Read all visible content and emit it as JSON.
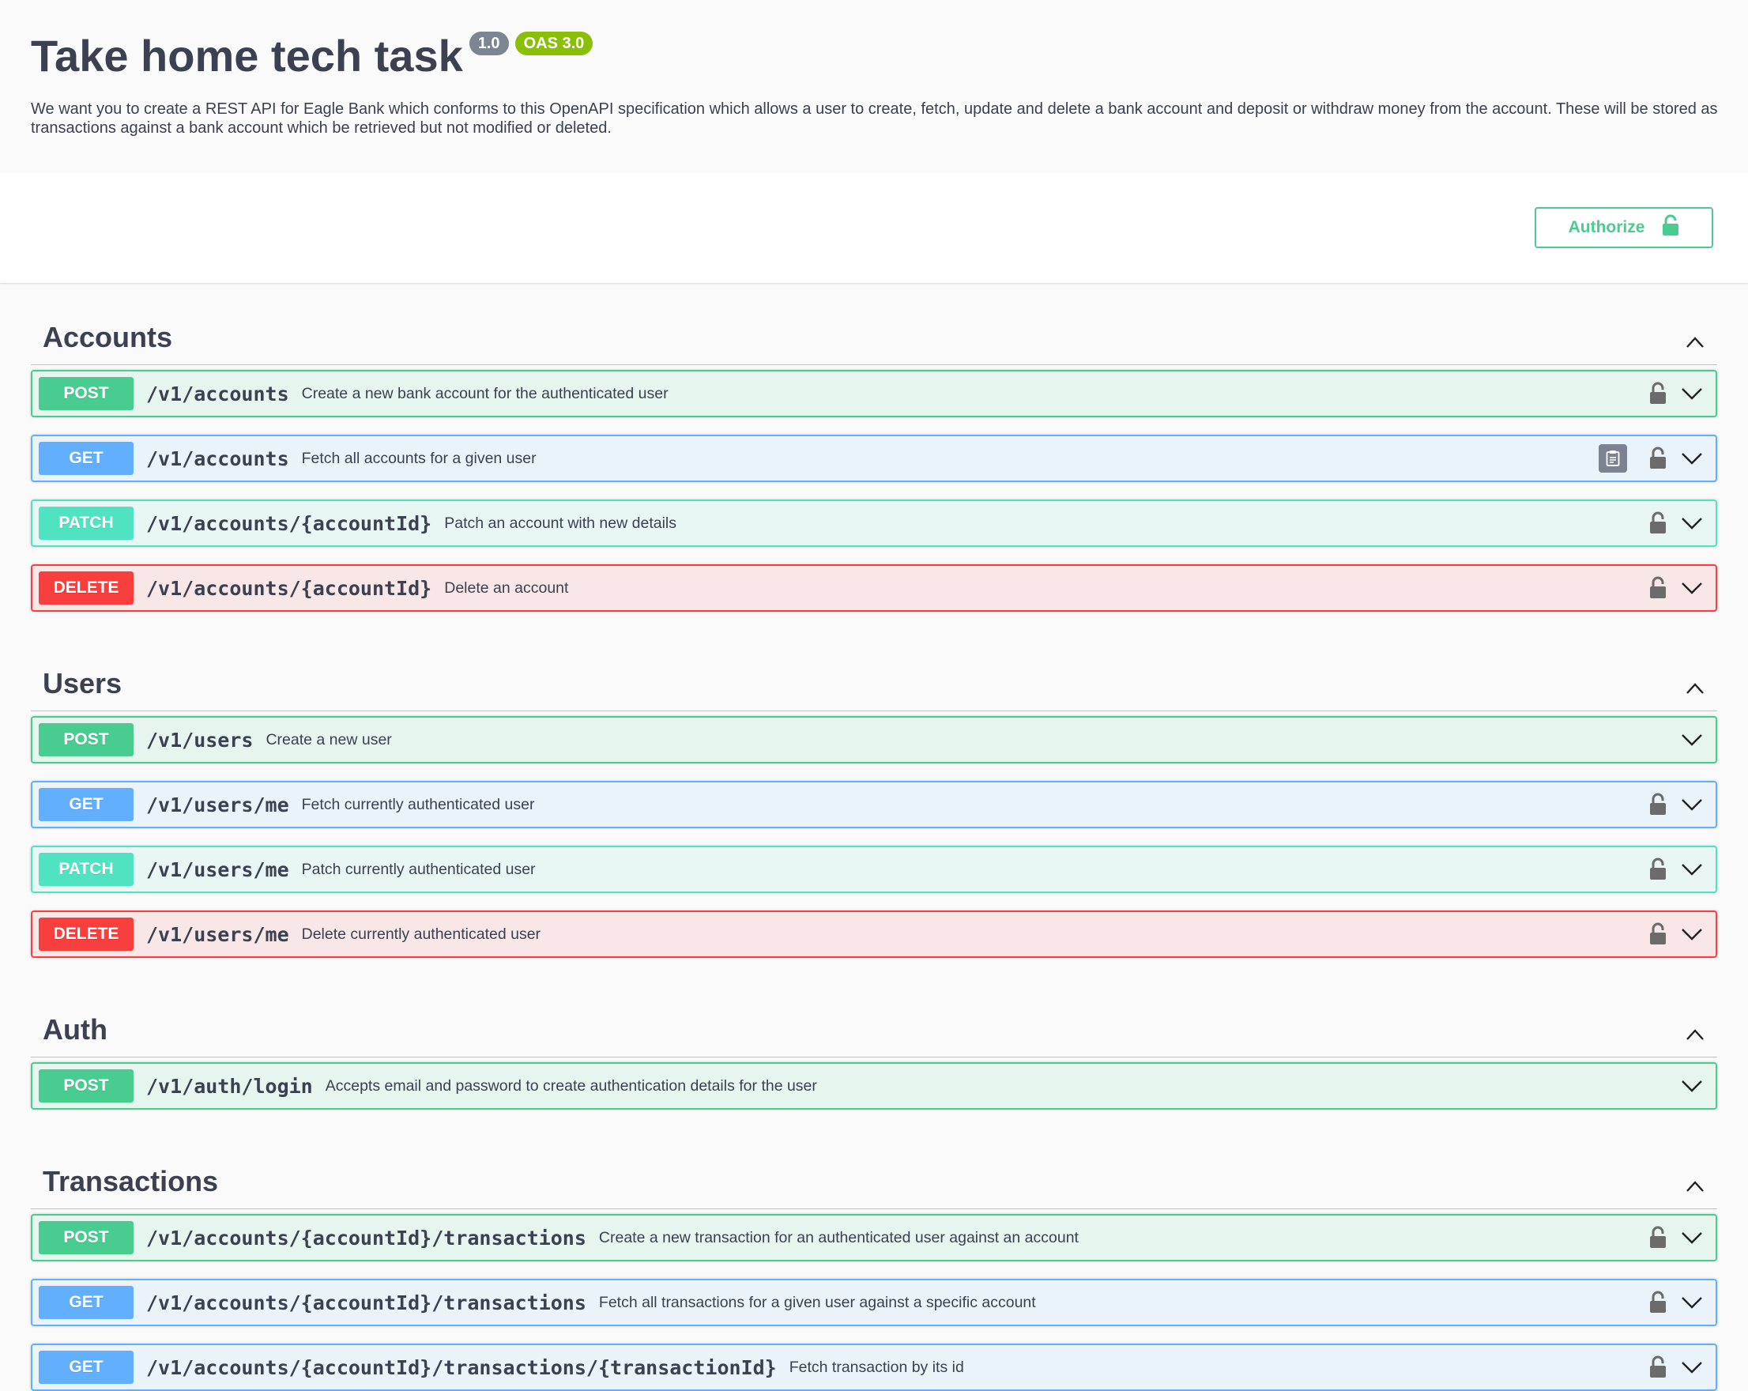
{
  "info": {
    "title": "Take home tech task",
    "version": "1.0",
    "oas": "OAS 3.0",
    "description": "We want you to create a REST API for Eagle Bank which conforms to this OpenAPI specification which allows a user to create, fetch, update and delete a bank account and deposit or withdraw money from the account. These will be stored as transactions against a bank account which be retrieved but not modified or deleted."
  },
  "authorize": {
    "label": "Authorize"
  },
  "tags": [
    {
      "name": "Accounts",
      "ops": [
        {
          "method": "POST",
          "path": "/v1/accounts",
          "summary": "Create a new bank account for the authenticated user",
          "lock": true
        },
        {
          "method": "GET",
          "path": "/v1/accounts",
          "summary": "Fetch all accounts for a given user",
          "lock": true,
          "copy": true
        },
        {
          "method": "PATCH",
          "path": "/v1/accounts/{accountId}",
          "summary": "Patch an account with new details",
          "lock": true
        },
        {
          "method": "DELETE",
          "path": "/v1/accounts/{accountId}",
          "summary": "Delete an account",
          "lock": true
        }
      ]
    },
    {
      "name": "Users",
      "ops": [
        {
          "method": "POST",
          "path": "/v1/users",
          "summary": "Create a new user",
          "lock": false
        },
        {
          "method": "GET",
          "path": "/v1/users/me",
          "summary": "Fetch currently authenticated user",
          "lock": true
        },
        {
          "method": "PATCH",
          "path": "/v1/users/me",
          "summary": "Patch currently authenticated user",
          "lock": true
        },
        {
          "method": "DELETE",
          "path": "/v1/users/me",
          "summary": "Delete currently authenticated user",
          "lock": true
        }
      ]
    },
    {
      "name": "Auth",
      "ops": [
        {
          "method": "POST",
          "path": "/v1/auth/login",
          "summary": "Accepts email and password to create authentication details for the user",
          "lock": false
        }
      ]
    },
    {
      "name": "Transactions",
      "ops": [
        {
          "method": "POST",
          "path": "/v1/accounts/{accountId}/transactions",
          "summary": "Create a new transaction for an authenticated user against an account",
          "lock": true
        },
        {
          "method": "GET",
          "path": "/v1/accounts/{accountId}/transactions",
          "summary": "Fetch all transactions for a given user against a specific account",
          "lock": true
        },
        {
          "method": "GET",
          "path": "/v1/accounts/{accountId}/transactions/{transactionId}",
          "summary": "Fetch transaction by its id",
          "lock": true
        }
      ]
    }
  ],
  "icons": {
    "lock": "padlock-icon",
    "expand": "chevron-down-icon",
    "collapse": "chevron-up-icon",
    "copy": "clipboard-icon"
  },
  "colors": {
    "post": "#49cc90",
    "get": "#61affe",
    "patch": "#50e3c2",
    "delete": "#f93e3e",
    "text": "#3b4151"
  }
}
